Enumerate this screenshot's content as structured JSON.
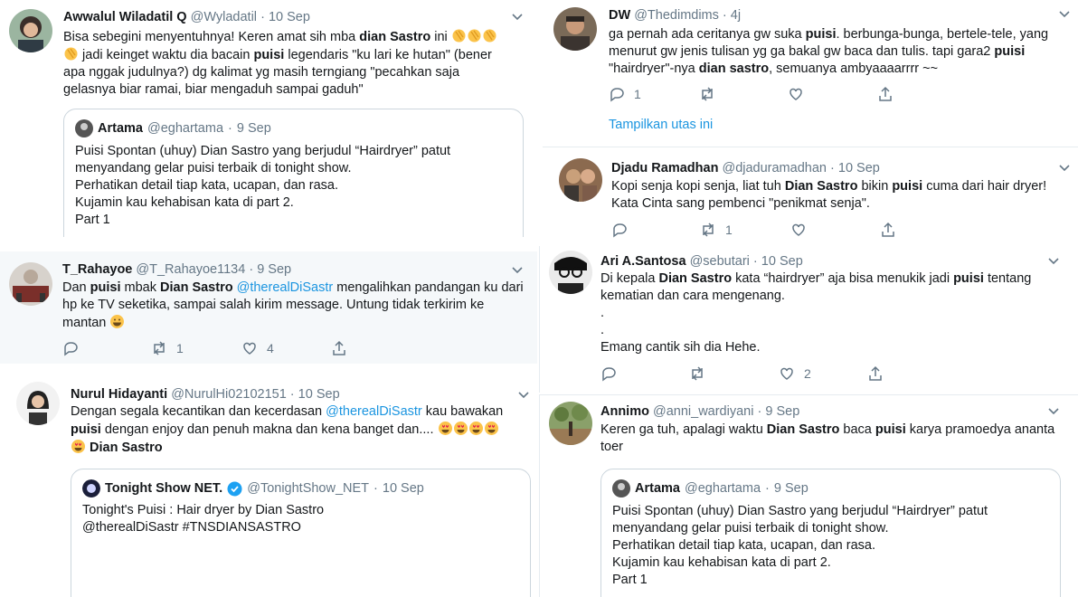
{
  "tweets": {
    "awwalul": {
      "name": "Awwalul Wiladatil Q",
      "handle": "@Wyladatil",
      "dot": "·",
      "date": "10 Sep",
      "t1": "Bisa sebegini menyentuhnya! Keren amat sih mba ",
      "b1": "dian Sastro",
      "t2": " ini ",
      "t3": " jadi keinget waktu dia bacain ",
      "b2": "puisi",
      "t4": " legendaris \"ku lari ke hutan\" (bener apa nggak judulnya?) dg kalimat yg masih terngiang \"pecahkan saja gelasnya biar ramai, biar mengaduh sampai gaduh\"",
      "quote": {
        "name": "Artama",
        "handle": "@eghartama",
        "dot": "·",
        "date": "9 Sep",
        "l1": "Puisi Spontan (uhuy) Dian Sastro yang berjudul “Hairdryer” patut",
        "l2": "menyandang gelar puisi terbaik di tonight show.",
        "l3": "Perhatikan detail tiap kata, ucapan, dan rasa.",
        "l4": "Kujamin kau kehabisan kata di part 2.",
        "l5": "Part 1"
      }
    },
    "dw": {
      "name": "DW",
      "handle": "@Thedimdims",
      "dot": "·",
      "date": "4j",
      "t1": "ga pernah ada ceritanya gw suka ",
      "b1": "puisi",
      "t2": ". berbunga-bunga, bertele-tele, yang menurut gw jenis tulisan yg ga bakal gw baca dan tulis. tapi gara2 ",
      "b2": "puisi",
      "t3": " \"hairdryer\"-nya ",
      "b3": "dian sastro",
      "t4": ", semuanya ambyaaaarrrr ~~",
      "reply_count": "1",
      "show_thread": "Tampilkan utas ini"
    },
    "djadu": {
      "name": "Djadu Ramadhan",
      "handle": "@djaduramadhan",
      "dot": "·",
      "date": "10 Sep",
      "t1": "Kopi senja kopi senja, liat tuh ",
      "b1": "Dian Sastro",
      "t2": " bikin ",
      "b2": "puisi",
      "t3": " cuma dari hair dryer! Kata Cinta sang pembenci \"penikmat senja\".",
      "retweet_count": "1"
    },
    "rahayoe": {
      "name": "T_Rahayoe",
      "handle": "@T_Rahayoe1134",
      "dot": "·",
      "date": "9 Sep",
      "t1": "Dan ",
      "b1": "puisi",
      "t2": " mbak ",
      "b2": "Dian Sastro",
      "m1": "@therealDiSastr",
      "t3": " mengalihkan pandangan ku dari hp ke TV seketika, sampai salah kirim message. Untung tidak terkirim ke mantan ",
      "retweet_count": "1",
      "like_count": "4"
    },
    "ari": {
      "name": "Ari A.Santosa",
      "handle": "@sebutari",
      "dot": "·",
      "date": "10 Sep",
      "t1": "Di kepala ",
      "b1": "Dian Sastro",
      "t2": " kata “hairdryer” aja bisa menukik jadi ",
      "b2": "puisi",
      "t3": " tentang kematian dan cara mengenang.",
      "l2": ".",
      "l3": ".",
      "l4": "Emang cantik sih dia Hehe.",
      "like_count": "2"
    },
    "nurul": {
      "name": "Nurul Hidayanti",
      "handle": "@NurulHi02102151",
      "dot": "·",
      "date": "10 Sep",
      "t1": "Dengan segala kecantikan dan kecerdasan ",
      "m1": "@therealDiSastr",
      "t2": " kau bawakan ",
      "b1": "puisi",
      "t3": " dengan enjoy dan penuh makna dan kena banget dan.... ",
      "b2": "Dian Sastro",
      "quote": {
        "name": "Tonight Show NET.",
        "handle": "@TonightShow_NET",
        "dot": "·",
        "date": "10 Sep",
        "l1": "Tonight's Puisi : Hair dryer by Dian Sastro",
        "l2": "@therealDiSastr  #TNSDIANSASTRO"
      }
    },
    "annimo": {
      "name": "Annimo",
      "handle": "@anni_wardiyani",
      "dot": "·",
      "date": "9 Sep",
      "t1": "Keren ga tuh, apalagi waktu ",
      "b1": "Dian Sastro",
      "t2": " baca ",
      "b2": "puisi",
      "t3": " karya pramoedya ananta toer",
      "quote": {
        "name": "Artama",
        "handle": "@eghartama",
        "dot": "·",
        "date": "9 Sep",
        "l1": "Puisi Spontan (uhuy) Dian Sastro yang berjudul “Hairdryer” patut",
        "l2": "menyandang gelar puisi terbaik di tonight show.",
        "l3": "Perhatikan detail tiap kata, ucapan, dan rasa.",
        "l4": "Kujamin kau kehabisan kata di part 2.",
        "l5": "Part 1"
      }
    }
  },
  "icons": [
    "reply-icon",
    "retweet-icon",
    "like-icon",
    "share-icon",
    "chevron-down-icon",
    "verified-badge-icon",
    "clapping-hands-emoji",
    "grinning-emoji",
    "heart-eyes-emoji"
  ],
  "colors": {
    "link": "#1b95e0",
    "muted": "#657786",
    "text": "#14171a",
    "border": "#ccd6dd",
    "highlight": "#f5f8fa",
    "verified": "#1da1f2"
  }
}
